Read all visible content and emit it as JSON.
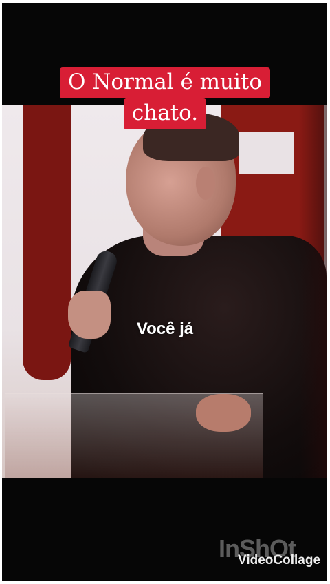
{
  "caption": {
    "line1": "O Normal é muito",
    "line2": "chato."
  },
  "subtitle": "Você já",
  "watermark": {
    "logo": "InShOt",
    "label": "VideoCollage"
  }
}
